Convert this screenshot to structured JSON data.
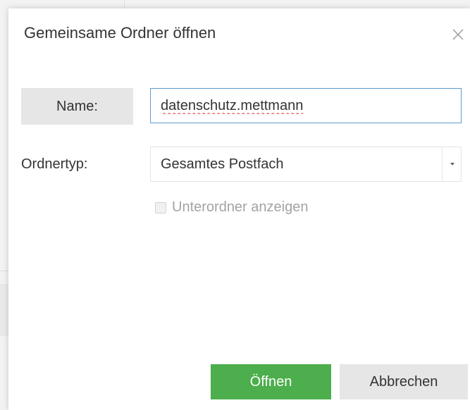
{
  "dialog": {
    "title": "Gemeinsame Ordner öffnen",
    "close_icon": "close-icon"
  },
  "form": {
    "name_label": "Name:",
    "name_value": "datenschutz.mettmann",
    "type_label": "Ordnertyp:",
    "type_value": "Gesamtes Postfach",
    "subfolder_label": "Unterordner anzeigen",
    "subfolder_checked": false,
    "subfolder_disabled": true
  },
  "buttons": {
    "open_label": "Öffnen",
    "cancel_label": "Abbrechen"
  },
  "colors": {
    "primary_button": "#4cae4c",
    "secondary_button": "#e6e6e6",
    "input_focus_border": "#5b9bd5"
  }
}
